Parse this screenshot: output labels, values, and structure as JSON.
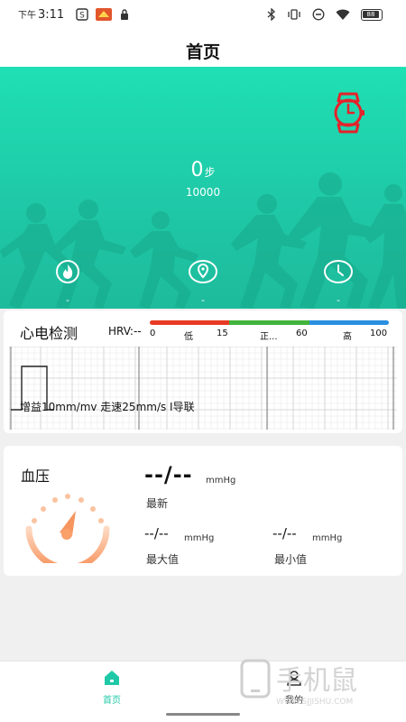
{
  "status_bar": {
    "ampm": "下午",
    "time": "3:11",
    "battery": "88"
  },
  "header": {
    "title": "首页"
  },
  "hero": {
    "steps": "0",
    "steps_unit": "步",
    "goal": "10000",
    "stats": [
      {
        "icon": "flame-icon",
        "value": "-"
      },
      {
        "icon": "location-pin-icon",
        "value": "-"
      },
      {
        "icon": "clock-icon",
        "value": "-"
      }
    ]
  },
  "ecg": {
    "title": "心电检测",
    "hrv_label": "HRV:--",
    "scale": [
      "0",
      "低",
      "15",
      "正...",
      "60",
      "高",
      "100"
    ],
    "caption": "增益10mm/mv 走速25mm/s I导联",
    "colors": {
      "low": "#e83a23",
      "normal": "#42b43c",
      "high": "#2a8fe0"
    }
  },
  "bp": {
    "title": "血压",
    "value": "--/--",
    "unit": "mmHg",
    "latest_label": "最新",
    "max": {
      "value": "--/--",
      "unit": "mmHg",
      "label": "最大值"
    },
    "min": {
      "value": "--/--",
      "unit": "mmHg",
      "label": "最小值"
    },
    "gauge_color": "#f9a06b"
  },
  "nav": {
    "home": "首页",
    "mine": "我的",
    "accent": "#1fc9a8"
  },
  "watermark": {
    "text": "手机鼠",
    "sub": "WWW.SJJISHU.COM"
  }
}
